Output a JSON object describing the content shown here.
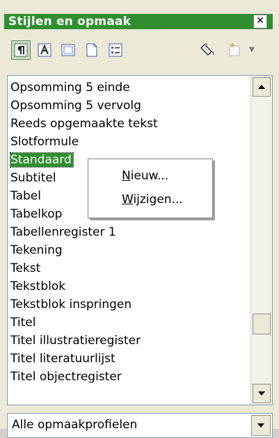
{
  "window": {
    "title": "Stijlen en opmaak",
    "close_label": "✕"
  },
  "toolbar": {
    "icons": [
      "paragraph-styles-icon",
      "character-styles-icon",
      "frame-styles-icon",
      "page-styles-icon",
      "list-styles-icon",
      "fill-format-icon",
      "new-style-icon"
    ]
  },
  "styles_list": {
    "items": [
      "Opsomming 5 einde",
      "Opsomming 5 vervolg",
      "Reeds opgemaakte tekst",
      "Slotformule",
      "Standaard",
      "Subtitel",
      "Tabel",
      "Tabelkop",
      "Tabellenregister 1",
      "Tekening",
      "Tekst",
      "Tekstblok",
      "Tekstblok inspringen",
      "Titel",
      "Titel illustratieregister",
      "Titel literatuurlijst",
      "Titel objectregister"
    ],
    "selected": "Standaard"
  },
  "context_menu": {
    "items": [
      {
        "mnemonic": "N",
        "rest": "ieuw..."
      },
      {
        "mnemonic": "W",
        "rest": "ijzigen..."
      }
    ]
  },
  "filter": {
    "value": "Alle opmaakprofielen"
  },
  "colors": {
    "accent": "#2f8f2f"
  }
}
